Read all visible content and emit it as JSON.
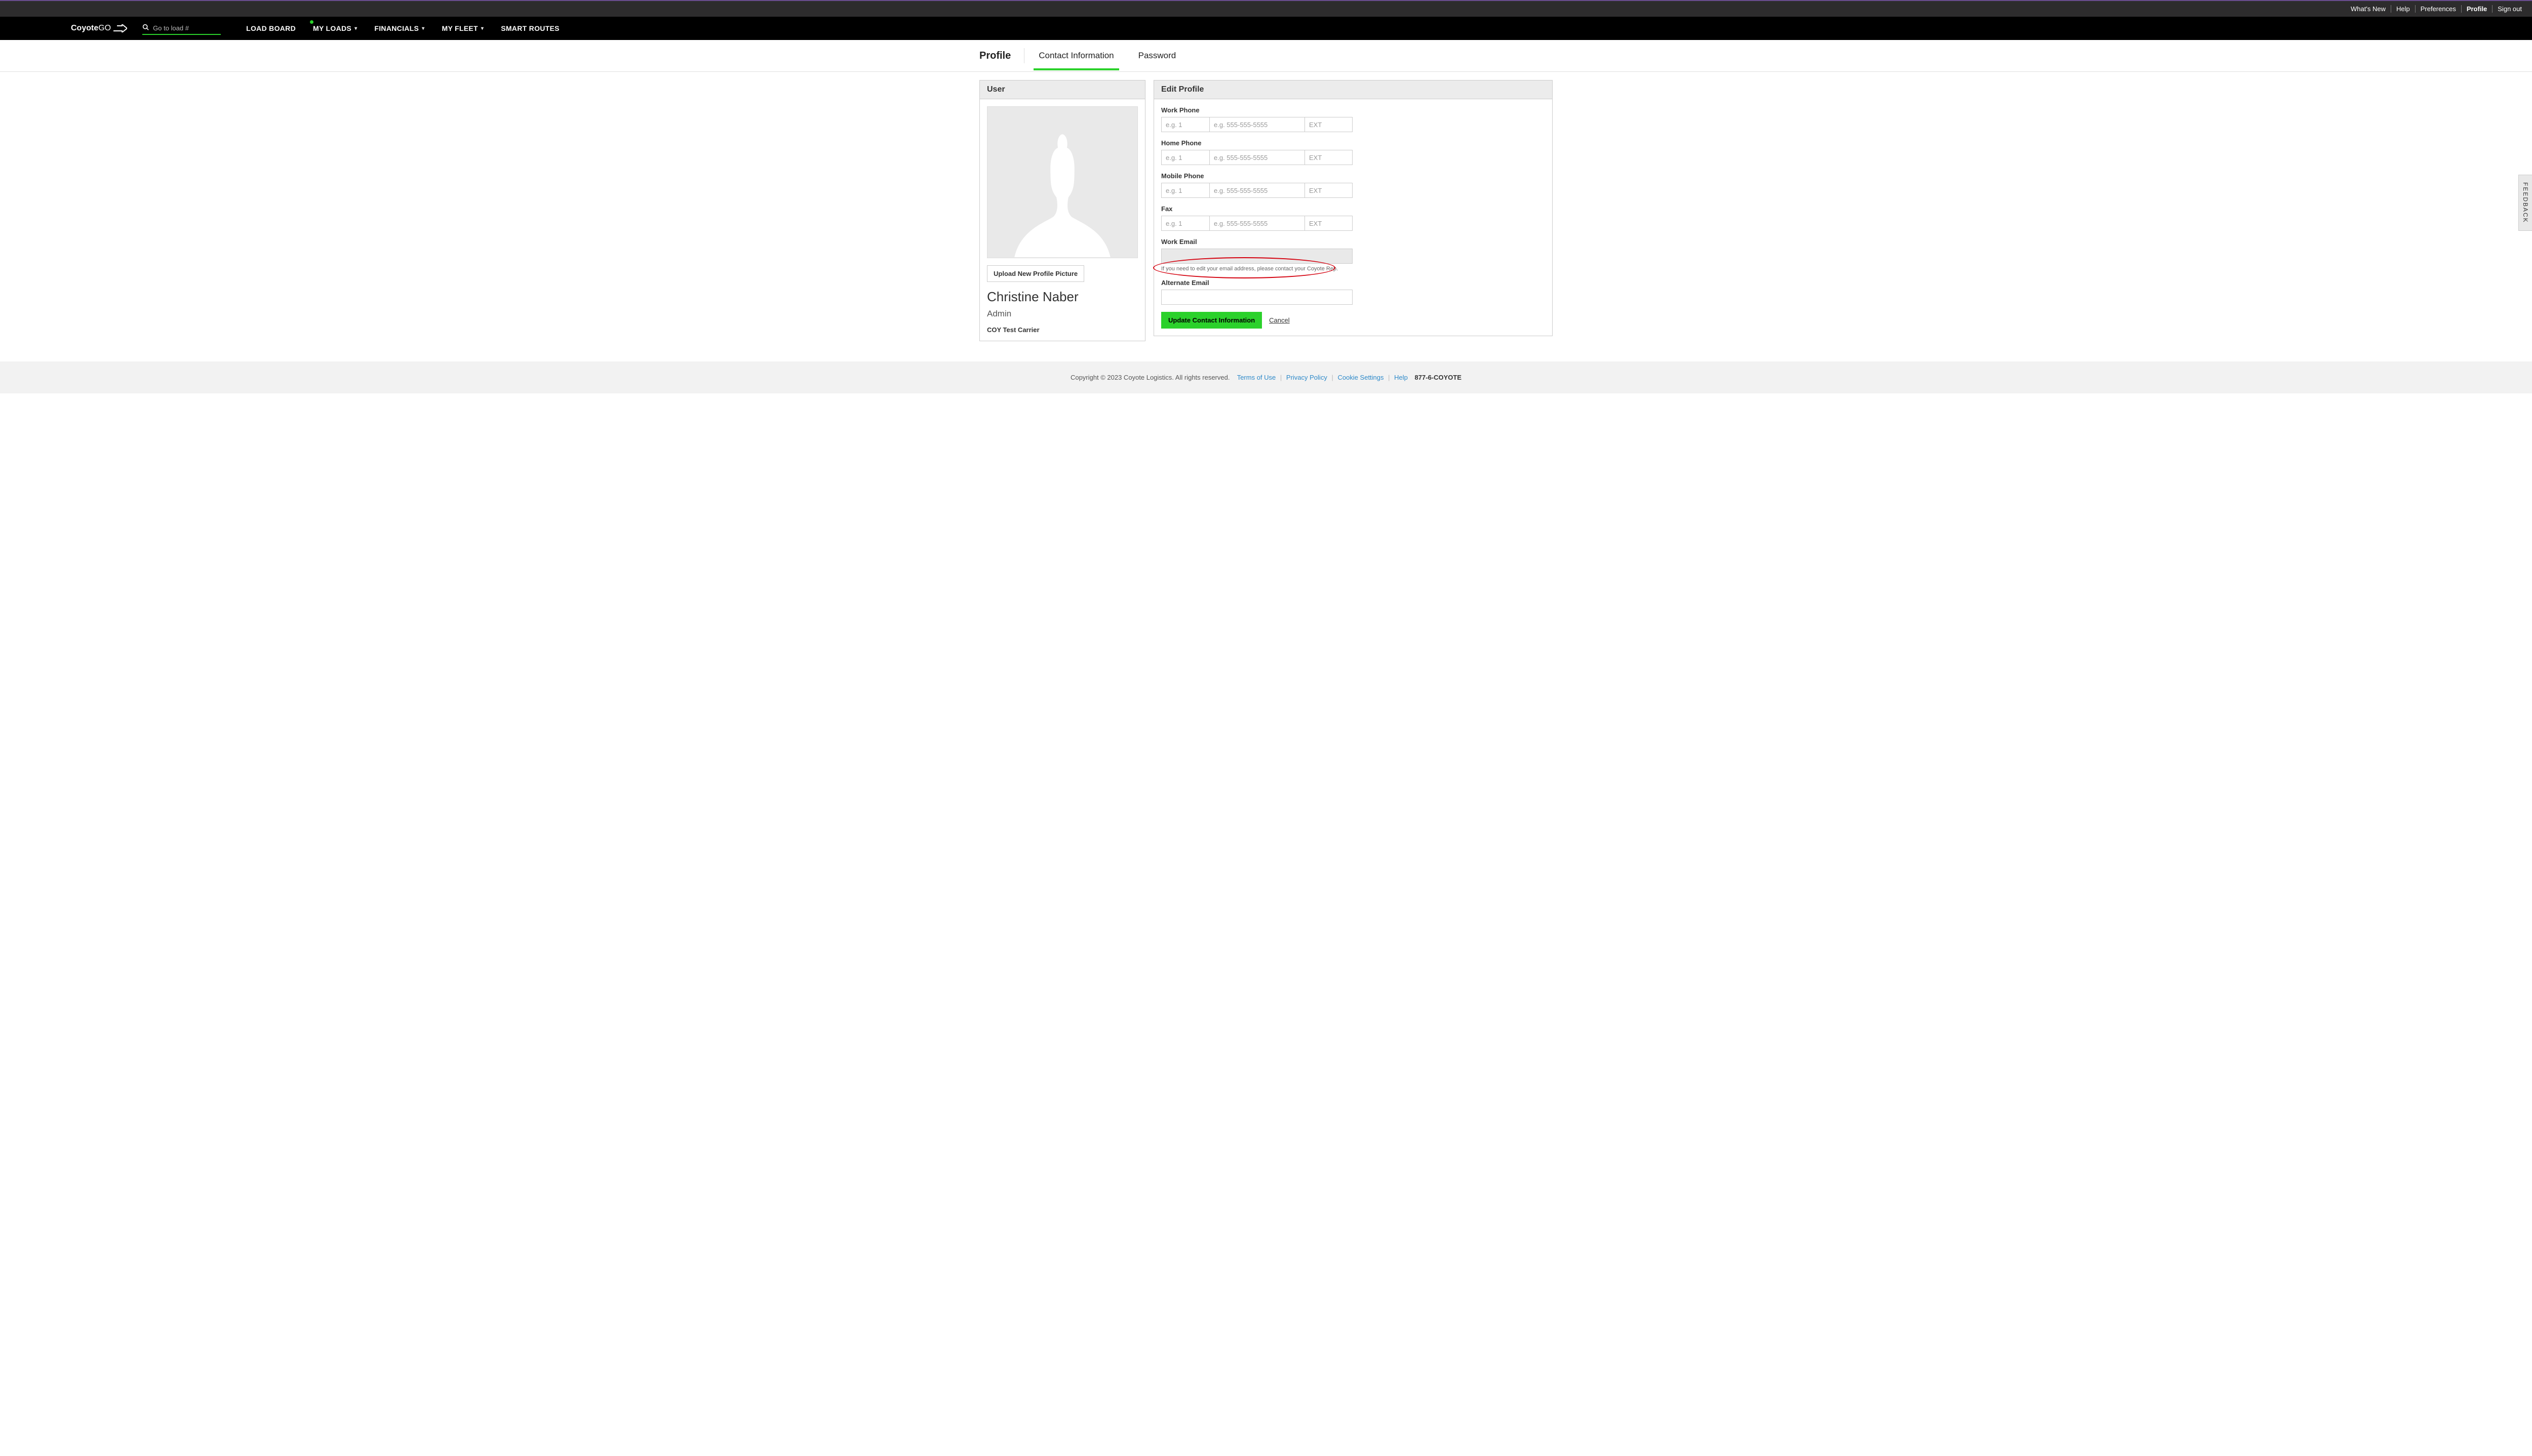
{
  "topbar": {
    "whats_new": "What's New",
    "help": "Help",
    "preferences": "Preferences",
    "profile": "Profile",
    "sign_out": "Sign out"
  },
  "brand": {
    "part1": "Coyote",
    "part2": "GO"
  },
  "search": {
    "placeholder": "Go to load #"
  },
  "nav": {
    "load_board": "LOAD BOARD",
    "my_loads": "MY LOADS",
    "financials": "FINANCIALS",
    "my_fleet": "MY FLEET",
    "smart_routes": "SMART ROUTES"
  },
  "subtabs": {
    "title": "Profile",
    "contact": "Contact Information",
    "password": "Password"
  },
  "user_panel": {
    "heading": "User",
    "upload_btn": "Upload New Profile Picture",
    "name": "Christine Naber",
    "role": "Admin",
    "carrier": "COY Test Carrier"
  },
  "edit_panel": {
    "heading": "Edit Profile",
    "work_phone_label": "Work Phone",
    "home_phone_label": "Home Phone",
    "mobile_phone_label": "Mobile Phone",
    "fax_label": "Fax",
    "work_email_label": "Work Email",
    "alt_email_label": "Alternate Email",
    "cc_placeholder": "e.g. 1",
    "num_placeholder": "e.g. 555-555-5555",
    "ext_placeholder": "EXT",
    "email_helper": "If you need to edit your email address, please contact your Coyote Rep.",
    "update_btn": "Update Contact Information",
    "cancel": "Cancel"
  },
  "feedback": {
    "label": "FEEDBACK"
  },
  "footer": {
    "copyright": "Copyright © 2023 Coyote Logistics. All rights reserved.",
    "terms": "Terms of Use",
    "privacy": "Privacy Policy",
    "cookies": "Cookie Settings",
    "help": "Help",
    "phone": "877-6-COYOTE"
  }
}
